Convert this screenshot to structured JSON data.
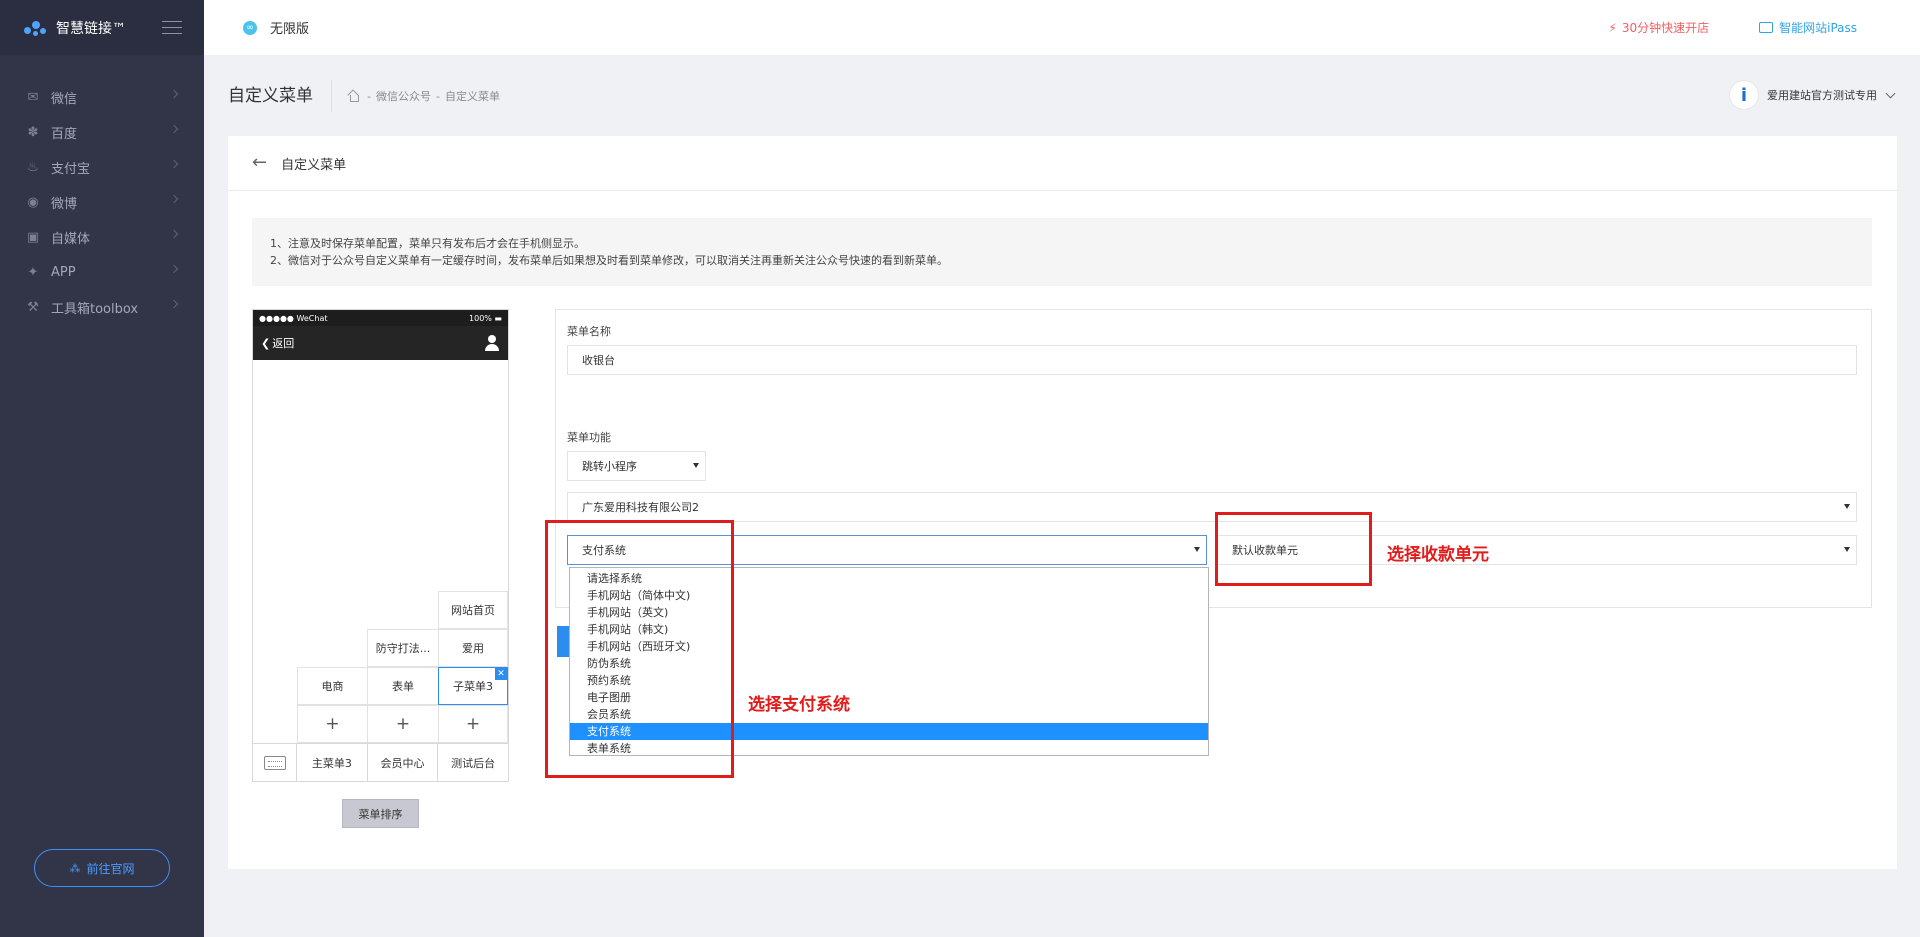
{
  "brand": {
    "name": "智慧链接™"
  },
  "sidebar": {
    "items": [
      {
        "label": "微信",
        "icon": "wechat-icon",
        "glyph": "✉"
      },
      {
        "label": "百度",
        "icon": "baidu-paw-icon",
        "glyph": "✽"
      },
      {
        "label": "支付宝",
        "icon": "alipay-icon",
        "glyph": "♨"
      },
      {
        "label": "微博",
        "icon": "weibo-icon",
        "glyph": "◉"
      },
      {
        "label": "自媒体",
        "icon": "media-icon",
        "glyph": "▣"
      },
      {
        "label": "APP",
        "icon": "android-icon",
        "glyph": "✦"
      },
      {
        "label": "工具箱toolbox",
        "icon": "wrench-icon",
        "glyph": "⚒"
      }
    ],
    "goto_label": "前往官网"
  },
  "topbar": {
    "edition": "无限版",
    "quick_open": "30分钟快速开店",
    "ipass": "智能网站iPass"
  },
  "header": {
    "title": "自定义菜单",
    "breadcrumb": [
      "微信公众号",
      "自定义菜单"
    ],
    "account": "爱用建站官方测试专用"
  },
  "card": {
    "title": "自定义菜单",
    "notices": [
      "1、注意及时保存菜单配置，菜单只有发布后才会在手机侧显示。",
      "2、微信对于公众号自定义菜单有一定缓存时间，发布菜单后如果想及时看到菜单修改，可以取消关注再重新关注公众号快速的看到新菜单。"
    ]
  },
  "phone": {
    "carrier": "●●●●● WeChat",
    "battery": "100%",
    "back_label": "返回",
    "submenus": {
      "col3": [
        "网站首页",
        "爱用",
        "子菜单3"
      ],
      "col2": [
        "防守打法...",
        "表单"
      ],
      "col1": [
        "电商"
      ],
      "add": "+"
    },
    "main_tabs": [
      "主菜单3",
      "会员中心",
      "测试后台"
    ],
    "sort_label": "菜单排序"
  },
  "form": {
    "name_label": "菜单名称",
    "name_value": "收银台",
    "func_label": "菜单功能",
    "func_value": "跳转小程序",
    "company_value": "广东爱用科技有限公司2",
    "system_value": "支付系统",
    "unit_value": "默认收款单元",
    "system_options": [
      "请选择系统",
      "手机网站（简体中文)",
      "手机网站（英文)",
      "手机网站（韩文)",
      "手机网站（西班牙文)",
      "防伪系统",
      "预约系统",
      "电子图册",
      "会员系统",
      "支付系统",
      "表单系统"
    ],
    "selected_option": "支付系统"
  },
  "annotations": {
    "unit_note": "选择收款单元",
    "system_note": "选择支付系统",
    "color": "#e21b1b"
  }
}
